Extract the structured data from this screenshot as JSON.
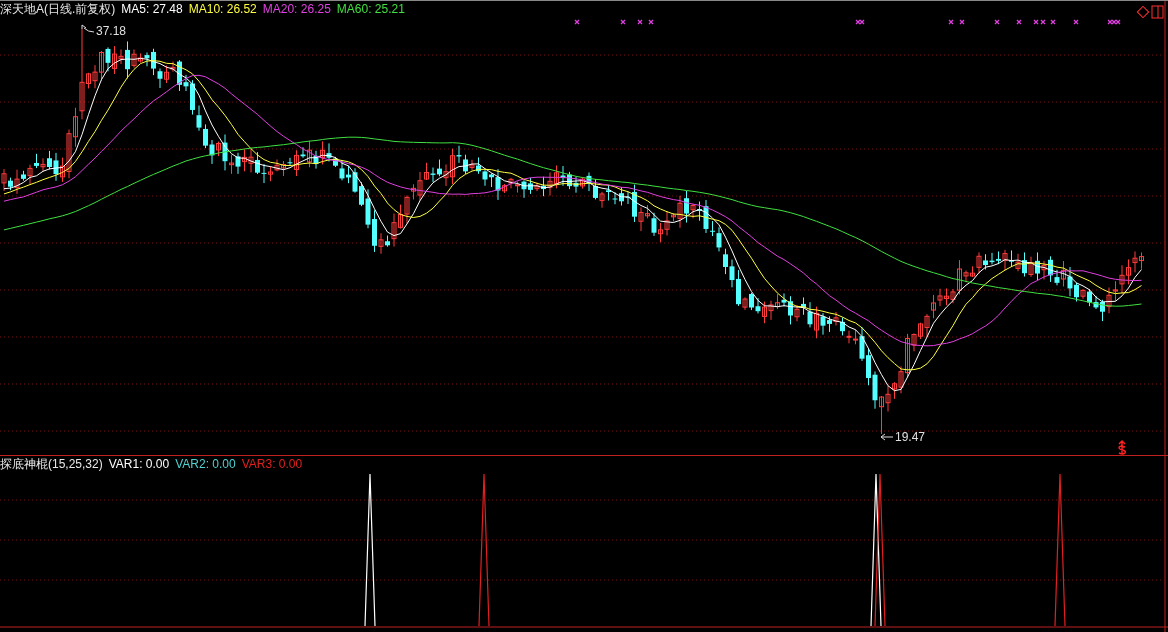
{
  "main_panel": {
    "title": "深天地A(日线.前复权)",
    "indicators": [
      {
        "label": "MA5: 27.48",
        "color": "#ffffff"
      },
      {
        "label": "MA10: 26.52",
        "color": "#ffff40"
      },
      {
        "label": "MA20: 26.25",
        "color": "#e040e0"
      },
      {
        "label": "MA60: 25.21",
        "color": "#40e040"
      }
    ],
    "high_label": "37.18",
    "low_label": "19.47"
  },
  "sub_panel": {
    "title": "探底神棍(15,25,32)",
    "indicators": [
      {
        "label": "VAR1: 0.00",
        "color": "#ffffff"
      },
      {
        "label": "VAR2: 0.00",
        "color": "#50d0d0"
      },
      {
        "label": "VAR3: 0.00",
        "color": "#e02020"
      }
    ]
  }
}
